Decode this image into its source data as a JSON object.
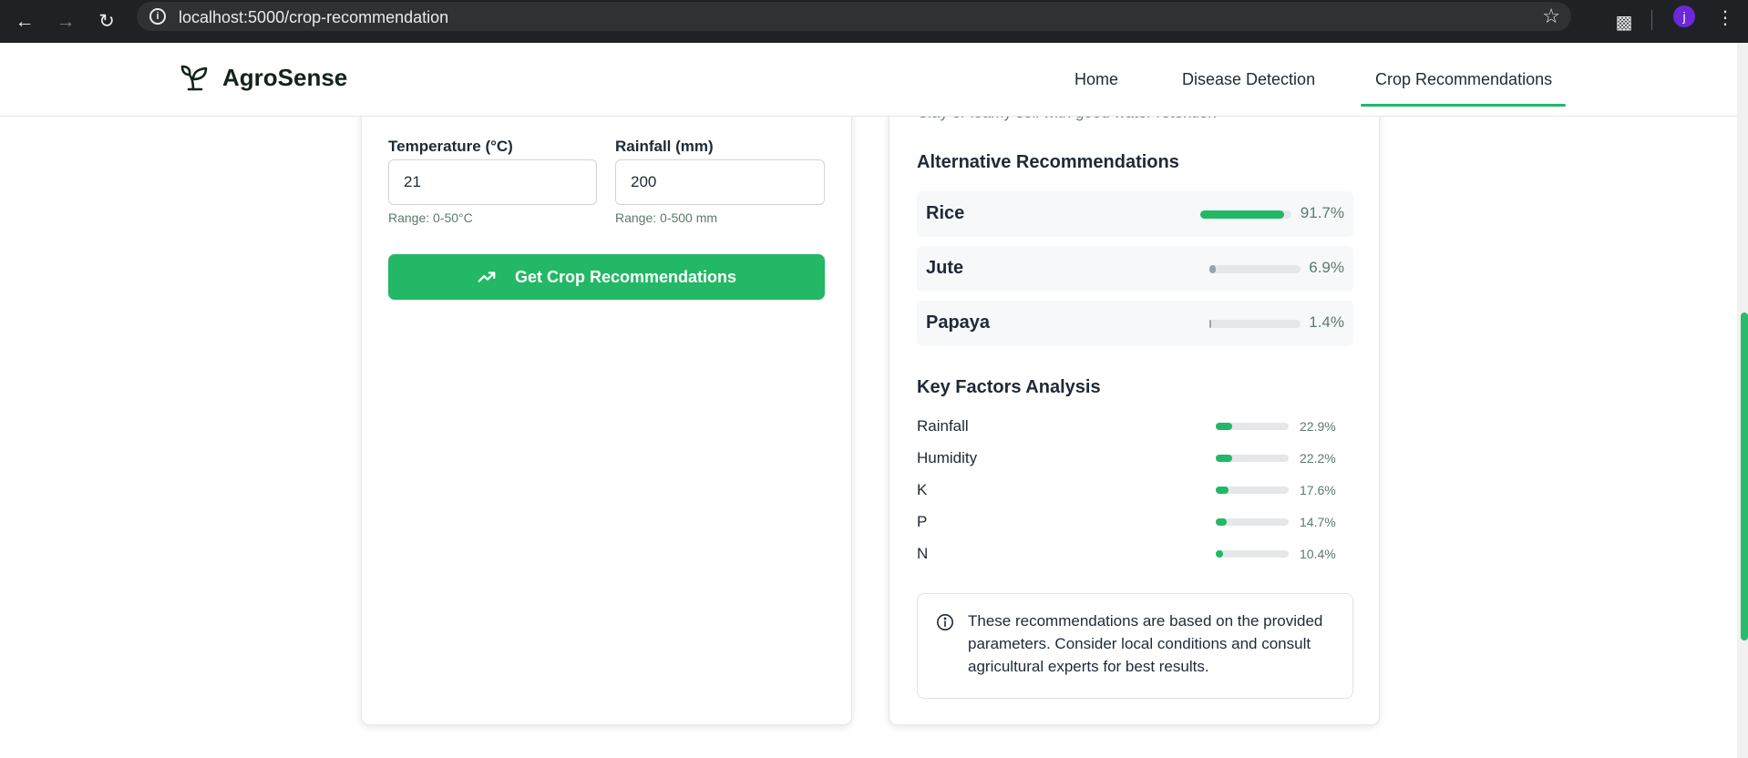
{
  "browser": {
    "url": "localhost:5000/crop-recommendation",
    "profile_initial": "j"
  },
  "header": {
    "brand": "AgroSense",
    "nav": [
      {
        "label": "Home",
        "active": false
      },
      {
        "label": "Disease Detection",
        "active": false
      },
      {
        "label": "Crop Recommendations",
        "active": true
      }
    ]
  },
  "form": {
    "temperature": {
      "label": "Temperature (°C)",
      "value": "21",
      "hint": "Range: 0-50°C"
    },
    "rainfall": {
      "label": "Rainfall (mm)",
      "value": "200",
      "hint": "Range: 0-500 mm"
    },
    "submit_label": "Get Crop Recommendations"
  },
  "results": {
    "soil_note_partial": "Clay or loamy soil with good water retention",
    "alternatives_title": "Alternative Recommendations",
    "alternatives": [
      {
        "name": "Rice",
        "percent": "91.7%",
        "fraction": 0.917,
        "color": "#22b865"
      },
      {
        "name": "Jute",
        "percent": "6.9%",
        "fraction": 0.069,
        "color": "#9ca3af"
      },
      {
        "name": "Papaya",
        "percent": "1.4%",
        "fraction": 0.014,
        "color": "#9ca3af"
      }
    ],
    "factors_title": "Key Factors Analysis",
    "factors": [
      {
        "name": "Rainfall",
        "percent": "22.9%",
        "fraction": 0.229
      },
      {
        "name": "Humidity",
        "percent": "22.2%",
        "fraction": 0.222
      },
      {
        "name": "K",
        "percent": "17.6%",
        "fraction": 0.176
      },
      {
        "name": "P",
        "percent": "14.7%",
        "fraction": 0.147
      },
      {
        "name": "N",
        "percent": "10.4%",
        "fraction": 0.104
      }
    ],
    "disclaimer": "These recommendations are based on the provided parameters. Consider local conditions and consult agricultural experts for best results."
  },
  "colors": {
    "accent": "#22b865",
    "muted_bar": "#9ca3af",
    "browser_bg": "#202124"
  },
  "icons": {
    "back": "arrow-left-icon",
    "forward": "arrow-right-icon",
    "reload": "reload-icon",
    "site_info": "info-icon",
    "bookmark": "star-icon",
    "extensions": "puzzle-icon",
    "menu": "more-vertical-icon",
    "brand": "sprout-icon",
    "submit": "trending-up-icon",
    "disclaimer": "info-icon"
  }
}
